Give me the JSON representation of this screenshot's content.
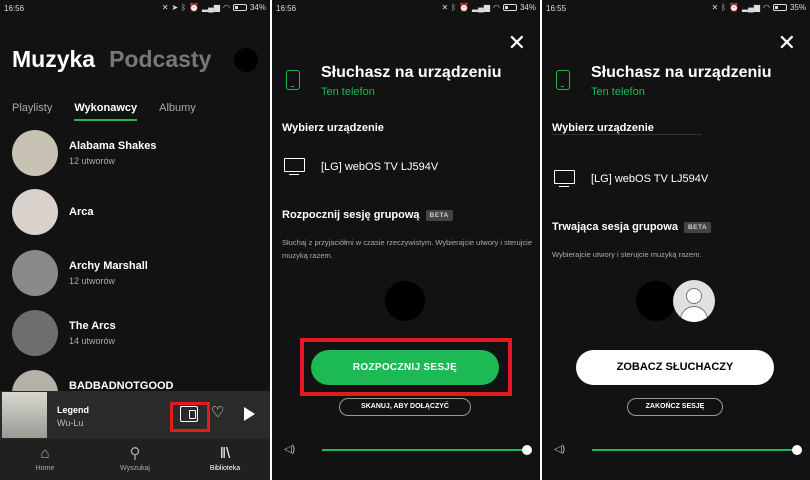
{
  "panel1": {
    "status": {
      "time": "16:56",
      "battery": "34%",
      "battery_level": 0.34
    },
    "header": {
      "active_tab": "Muzyka",
      "inactive_tab": "Podcasty"
    },
    "subtabs": [
      "Playlisty",
      "Wykonawcy",
      "Albumy"
    ],
    "selected_subtab": "Wykonawcy",
    "artists": [
      {
        "name": "Alabama Shakes",
        "count": "12 utworów",
        "color": "#c8c2b4"
      },
      {
        "name": "Arca",
        "count": "",
        "color": "#d9d2cc"
      },
      {
        "name": "Archy Marshall",
        "count": "12 utworów",
        "color": "#8a8a8a"
      },
      {
        "name": "The Arcs",
        "count": "14 utworów",
        "color": "#6e6e6e"
      },
      {
        "name": "BADBADNOTGOOD",
        "count": "",
        "color": "#b5b0a8"
      }
    ],
    "player": {
      "title": "Legend",
      "artist": "Wu-Lu"
    },
    "nav": [
      {
        "label": "Home",
        "icon": "home-icon",
        "glyph": "⌂"
      },
      {
        "label": "Wyszukaj",
        "icon": "search-icon",
        "glyph": "⚲"
      },
      {
        "label": "Biblioteka",
        "icon": "library-icon",
        "glyph": "‖\\"
      }
    ],
    "selected_nav": "Biblioteka"
  },
  "panel2": {
    "status": {
      "time": "16:56",
      "battery": "34%",
      "battery_level": 0.34
    },
    "listening_title": "Słuchasz na urządzeniu",
    "listening_device": "Ten telefon",
    "choose_device": "Wybierz urządzenie",
    "tv_name": "[LG] webOS TV LJ594V",
    "group_title": "Rozpocznij sesję grupową",
    "beta": "BETA",
    "group_desc": "Słuchaj z przyjaciółmi w czasie rzeczywistym. Wybierajcie utwory i sterujcie muzyką razem.",
    "primary_button": "ROZPOCZNIJ SESJĘ",
    "secondary_button": "SKANUJ, ABY DOŁĄCZYĆ",
    "volume": 1.0
  },
  "panel3": {
    "status": {
      "time": "16:55",
      "battery": "35%",
      "battery_level": 0.35
    },
    "listening_title": "Słuchasz na urządzeniu",
    "listening_device": "Ten telefon",
    "choose_device": "Wybierz urządzenie",
    "tv_name": "[LG] webOS TV LJ594V",
    "group_title": "Trwająca sesja grupowa",
    "beta": "BETA",
    "group_desc": "Wybierajcie utwory i sterujcie muzyką razem.",
    "primary_button": "ZOBACZ SŁUCHACZY",
    "secondary_button": "ZAKOŃCZ SESJĘ",
    "volume": 1.0
  },
  "colors": {
    "accent": "#1db954",
    "highlight": "#e21b22",
    "background": "#121212"
  }
}
